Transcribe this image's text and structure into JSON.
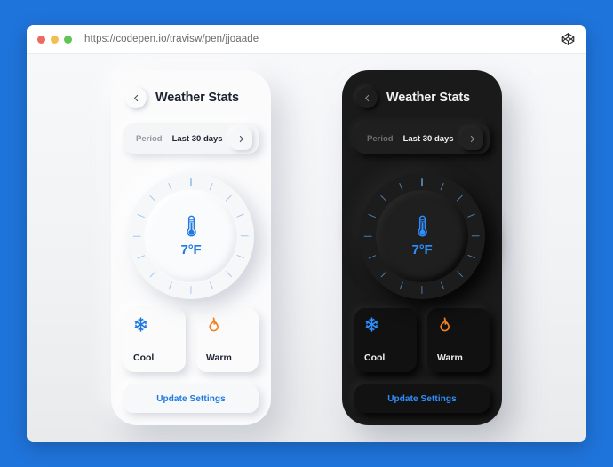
{
  "background": {
    "color": "#1f74db"
  },
  "browser": {
    "url": "https://codepen.io/travisw/pen/jjoaade",
    "traffic_lights": [
      "red",
      "yellow",
      "green"
    ],
    "right_icon": "codepen-logo-icon"
  },
  "phones": [
    {
      "theme": "light",
      "header": {
        "back_icon": "chevron-left-icon",
        "title": "Weather Stats"
      },
      "period": {
        "label": "Period",
        "value": "Last 30 days",
        "next_icon": "chevron-right-icon"
      },
      "dial": {
        "icon": "thermometer-icon",
        "temperature": "7°F",
        "tick_count": 16,
        "tick_color": "#a8c8ec",
        "value_color": "#1f7ae0"
      },
      "modes": [
        {
          "icon": "snowflake-icon",
          "label": "Cool",
          "color": "#1f7ae0"
        },
        {
          "icon": "flame-icon",
          "label": "Warm",
          "color": "#f58220"
        }
      ],
      "action": {
        "label": "Update Settings",
        "color": "#1f7ae0"
      }
    },
    {
      "theme": "dark",
      "header": {
        "back_icon": "chevron-left-icon",
        "title": "Weather Stats"
      },
      "period": {
        "label": "Period",
        "value": "Last 30 days",
        "next_icon": "chevron-right-icon"
      },
      "dial": {
        "icon": "thermometer-icon",
        "temperature": "7°F",
        "tick_count": 16,
        "tick_color": "#4f7ba8",
        "value_color": "#2e90ff"
      },
      "modes": [
        {
          "icon": "snowflake-icon",
          "label": "Cool",
          "color": "#2e90ff"
        },
        {
          "icon": "flame-icon",
          "label": "Warm",
          "color": "#f58220"
        }
      ],
      "action": {
        "label": "Update Settings",
        "color": "#2e90ff"
      }
    }
  ]
}
